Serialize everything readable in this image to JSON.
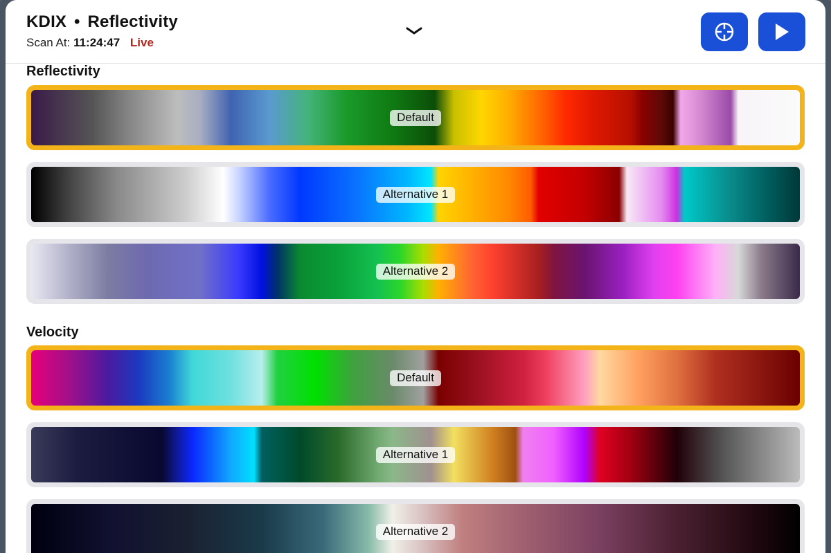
{
  "header": {
    "station": "KDIX",
    "separator": "•",
    "product": "Reflectivity",
    "scan_prefix": "Scan At:",
    "scan_time": "11:24:47",
    "status": "Live"
  },
  "icons": {
    "collapse": "chevron-down-icon",
    "locate": "crosshair-icon",
    "play": "play-icon"
  },
  "colors": {
    "accent": "#1a4fd8",
    "selected": "#f2b418",
    "live": "#b3261e"
  },
  "sections": [
    {
      "title": "Reflectivity",
      "scales": [
        {
          "label": "Default",
          "selected": true
        },
        {
          "label": "Alternative 1",
          "selected": false
        },
        {
          "label": "Alternative 2",
          "selected": false
        }
      ]
    },
    {
      "title": "Velocity",
      "scales": [
        {
          "label": "Default",
          "selected": true
        },
        {
          "label": "Alternative 1",
          "selected": false
        },
        {
          "label": "Alternative 2",
          "selected": false
        }
      ]
    }
  ]
}
